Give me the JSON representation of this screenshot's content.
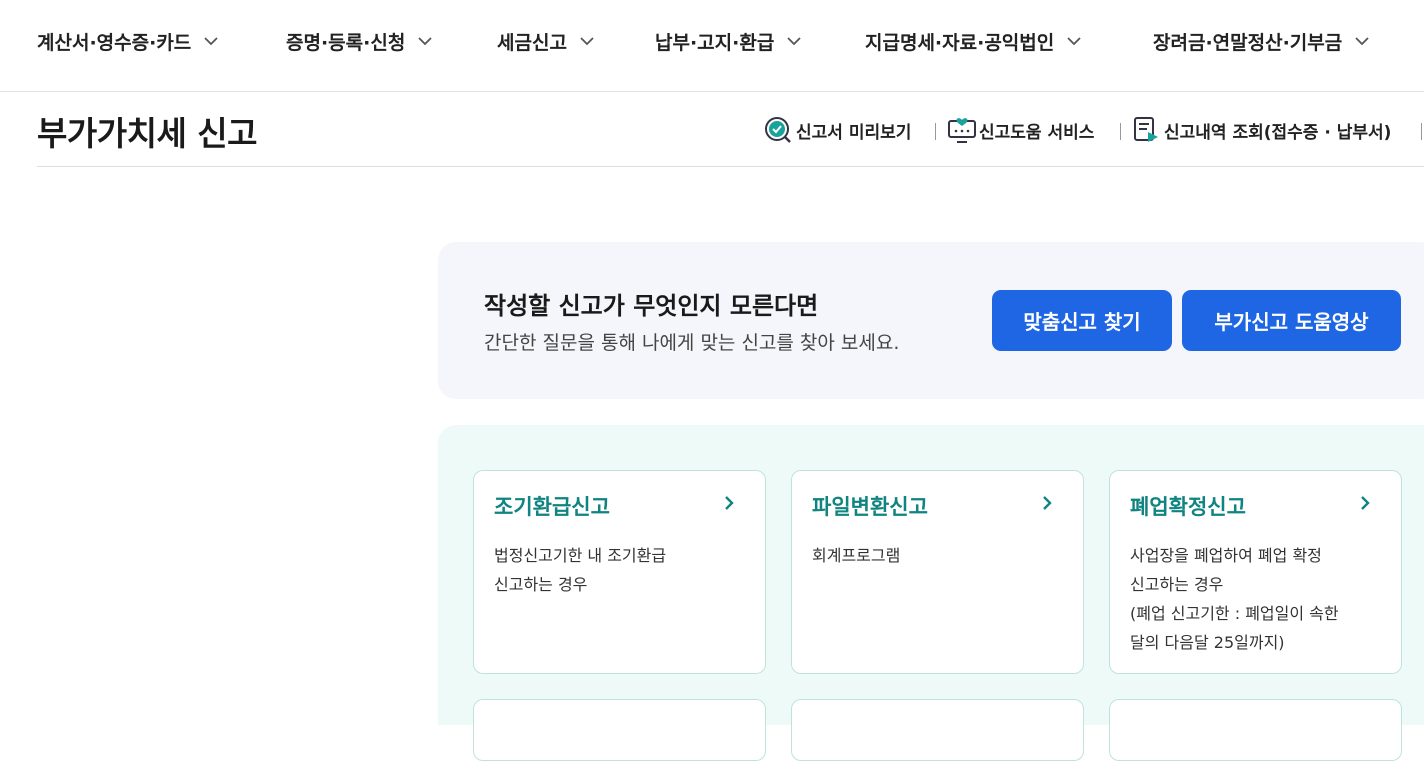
{
  "nav": {
    "items": [
      {
        "label": "계산서·영수증·카드"
      },
      {
        "label": "증명·등록·신청"
      },
      {
        "label": "세금신고"
      },
      {
        "label": "납부·고지·환급"
      },
      {
        "label": "지급명세·자료·공익법인"
      },
      {
        "label": "장려금·연말정산·기부금"
      }
    ]
  },
  "page": {
    "title": "부가가치세 신고",
    "utils": [
      {
        "label": "신고서 미리보기",
        "icon": "preview-check-icon"
      },
      {
        "label": "신고도움 서비스",
        "icon": "help-monitor-icon"
      },
      {
        "label": "신고내역 조회(접수증 · 납부서)",
        "icon": "document-history-icon"
      }
    ]
  },
  "guide": {
    "title": "작성할 신고가 무엇인지 모른다면",
    "desc": "간단한 질문을 통해 나에게 맞는 신고를 찾아 보세요.",
    "btn_find": "맞춤신고 찾기",
    "btn_video": "부가신고 도움영상"
  },
  "cards": [
    {
      "title": "조기환급신고",
      "desc": "법정신고기한 내 조기환급\n신고하는 경우"
    },
    {
      "title": "파일변환신고",
      "desc": "회계프로그램"
    },
    {
      "title": "폐업확정신고",
      "desc": "사업장을 폐업하여 폐업 확정\n신고하는 경우\n(폐업 신고기한 : 폐업일이 속한\n달의 다음달 25일까지)"
    }
  ],
  "colors": {
    "accent_blue": "#1f66e5",
    "card_title_teal": "#0f8480",
    "cards_bg": "#eefaf7",
    "guide_bg": "#f4f6fb"
  }
}
